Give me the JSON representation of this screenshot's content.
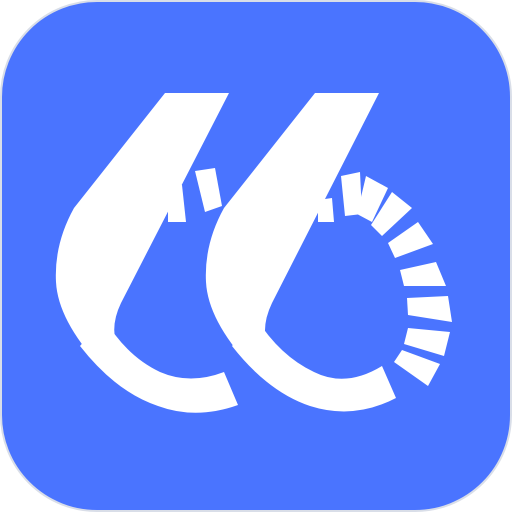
{
  "app_icon": {
    "icon": "app-logo-icon",
    "colors": {
      "tile_background": "#4A74FF",
      "tile_border": "#D9DEE8",
      "glyph": "#FFFFFF",
      "page_background": "#FFFFFF"
    }
  }
}
